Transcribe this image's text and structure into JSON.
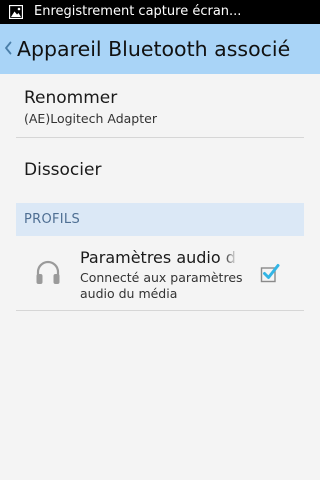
{
  "status_bar": {
    "notification_icon": "image-icon",
    "text": "Enregistrement capture écran..."
  },
  "action_bar": {
    "back_icon": "chevron-left-icon",
    "title": "Appareil Bluetooth associé",
    "background": "#a9d4f7"
  },
  "rename": {
    "title": "Renommer",
    "device_name": "(AE)Logitech Adapter"
  },
  "unpair": {
    "title": "Dissocier"
  },
  "profiles": {
    "header": "PROFILS",
    "header_background": "#dbe8f6",
    "items": [
      {
        "icon": "headset-icon",
        "title": "Paramètres audio du média",
        "summary": "Connecté aux paramètres audio du média",
        "checked": true
      }
    ]
  },
  "colors": {
    "accent": "#33b5e5",
    "divider": "#d6d6d6"
  }
}
